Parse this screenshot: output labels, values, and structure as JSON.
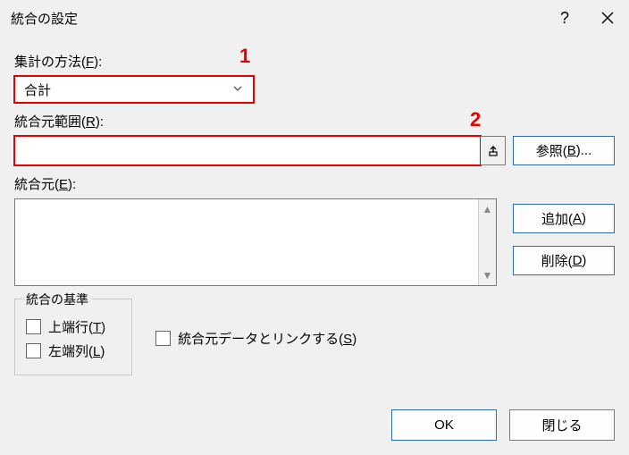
{
  "titlebar": {
    "title": "統合の設定",
    "help_label": "?",
    "close_label": "×"
  },
  "annotations": {
    "n1": "1",
    "n2": "2"
  },
  "function": {
    "label_pre": "集計の方法(",
    "label_accel": "F",
    "label_post": "):",
    "selected": "合計"
  },
  "reference": {
    "label_pre": "統合元範囲(",
    "label_accel": "R",
    "label_post": "):",
    "value": "",
    "browse_pre": "参照(",
    "browse_accel": "B",
    "browse_post": ")..."
  },
  "all_refs": {
    "label_pre": "統合元(",
    "label_accel": "E",
    "label_post": "):",
    "add_pre": "追加(",
    "add_accel": "A",
    "add_post": ")",
    "delete_pre": "削除(",
    "delete_accel": "D",
    "delete_post": ")"
  },
  "labels_group": {
    "legend": "統合の基準",
    "top_row_pre": "上端行(",
    "top_row_accel": "T",
    "top_row_post": ")",
    "left_col_pre": "左端列(",
    "left_col_accel": "L",
    "left_col_post": ")"
  },
  "link_source": {
    "pre": "統合元データとリンクする(",
    "accel": "S",
    "post": ")"
  },
  "buttons": {
    "ok": "OK",
    "close": "閉じる"
  }
}
